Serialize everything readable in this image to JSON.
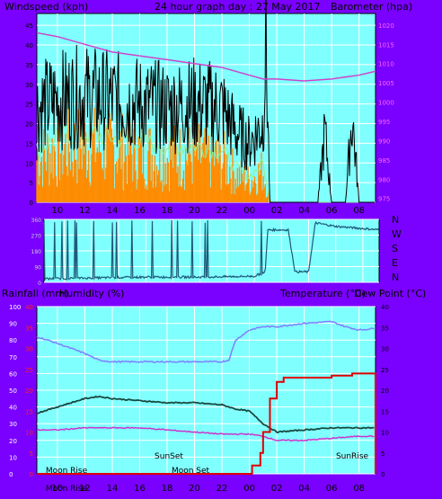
{
  "header": {
    "wind_label": "Windspeed (kph)",
    "title": "24 hour graph day : 27 May 2017",
    "baro_label": "Barometer (hpa)"
  },
  "mid_header": {
    "rain_label": "Rainfall (mm)",
    "humidity_label": "Humidity (%)",
    "temp_label": "Temperature (°C)",
    "dew_label": "Dew Point (°C)"
  },
  "dir_labels": [
    "N",
    "W",
    "S",
    "E",
    "N"
  ],
  "colors": {
    "frame": "#7a00ff",
    "plot_bg": "#80ffff",
    "grid": "#ffffff",
    "wind_gust": "#000000",
    "wind_avg": "#ff8c00",
    "wind_avg_line": "#90ee90",
    "barometer": "#cc44cc",
    "direction": "#1f5a78",
    "rain": "#e00000",
    "humidity": "#7f7fff",
    "temperature": "#1a4a40",
    "dewpoint": "#cc33cc"
  },
  "chart_data": [
    {
      "type": "line",
      "name": "wind-baro",
      "x_ticks": [
        "10",
        "12",
        "14",
        "16",
        "18",
        "20",
        "22",
        "00",
        "02",
        "04",
        "06",
        "08"
      ],
      "y_left_ticks": [
        0,
        5,
        10,
        15,
        20,
        25,
        30,
        35,
        40,
        45
      ],
      "y_right_ticks": [
        975,
        980,
        985,
        990,
        995,
        1000,
        1005,
        1010,
        1015,
        1020
      ],
      "ylim_left": [
        0,
        48
      ],
      "ylim_right": [
        974,
        1023
      ],
      "xlim_hours": [
        8.5,
        33.2
      ],
      "barometer": {
        "x": [
          8.5,
          10,
          12,
          14,
          16,
          18,
          20,
          21,
          22,
          23,
          24,
          25,
          26,
          28,
          30,
          32,
          33.2
        ],
        "y": [
          1018,
          1017,
          1015,
          1013,
          1012,
          1011,
          1010,
          1009.5,
          1009,
          1008,
          1007,
          1006,
          1006,
          1005.5,
          1006,
          1007,
          1008
        ]
      },
      "gust_profile": {
        "x": [
          8.5,
          10,
          12,
          14,
          16,
          18,
          20,
          22,
          23,
          24,
          25,
          25.2,
          25.5,
          28,
          29,
          29.5,
          30,
          31,
          31.5,
          32,
          33.2
        ],
        "y": [
          24,
          26,
          27,
          26,
          25,
          24,
          25,
          24,
          18,
          15,
          20,
          42,
          0,
          0,
          0,
          18,
          0,
          0,
          22,
          0,
          0
        ]
      },
      "avg_profile": {
        "x": [
          8.5,
          10,
          12,
          14,
          16,
          18,
          20,
          22,
          23,
          24,
          25,
          25.5,
          33.2
        ],
        "y": [
          12,
          15,
          16,
          15,
          14,
          13,
          13,
          12,
          8,
          6,
          9,
          0,
          0
        ]
      }
    },
    {
      "type": "line",
      "name": "direction",
      "y_ticks": [
        0,
        90,
        180,
        270,
        360
      ],
      "x": [
        8.5,
        12,
        16,
        20,
        24,
        24.8,
        25,
        26.5,
        27,
        28,
        28.5,
        30,
        33.2
      ],
      "y": [
        20,
        25,
        30,
        30,
        35,
        60,
        300,
        300,
        60,
        60,
        340,
        320,
        300
      ]
    },
    {
      "type": "line",
      "name": "temp-hum-rain",
      "x_ticks": [
        "10",
        "12",
        "14",
        "16",
        "18",
        "20",
        "22",
        "00",
        "02",
        "04",
        "06",
        "08"
      ],
      "y_left_ticks": [
        0,
        10,
        20,
        30,
        40,
        50,
        60,
        70,
        80,
        90,
        100
      ],
      "y_rain_ticks": [
        0,
        5,
        10,
        15,
        20,
        25,
        30,
        35,
        40
      ],
      "y_right_ticks": [
        0,
        5,
        10,
        15,
        20,
        25,
        30,
        35,
        40
      ],
      "annotations": {
        "sunset": "SunSet",
        "sunrise": "SunRise",
        "moonrise": "Moon Rise",
        "moonset": "Moon Set",
        "moonrise_bottom": "Moon Rise"
      },
      "humidity": {
        "x": [
          8.5,
          10,
          12,
          13,
          14,
          16,
          18,
          20,
          22,
          22.5,
          23,
          24,
          25,
          26,
          28,
          30,
          31,
          32,
          33.2
        ],
        "y": [
          82,
          78,
          72,
          68,
          67,
          67,
          67,
          67,
          67,
          68,
          80,
          86,
          88,
          88,
          90,
          91,
          88,
          86,
          87
        ]
      },
      "temperature": {
        "x": [
          8.5,
          10,
          11,
          12,
          13,
          14,
          16,
          18,
          20,
          22,
          23,
          24,
          25,
          26,
          28,
          30,
          32,
          33.2
        ],
        "y": [
          14.5,
          16,
          17,
          18,
          18.5,
          18,
          17.5,
          17,
          17,
          16.5,
          15.5,
          15,
          12,
          10,
          10.5,
          11,
          11,
          11
        ]
      },
      "dewpoint": {
        "x": [
          8.5,
          10,
          12,
          14,
          16,
          18,
          20,
          22,
          24,
          25,
          26,
          28,
          30,
          32,
          33.2
        ],
        "y": [
          10.5,
          10.5,
          11,
          11,
          11,
          10.5,
          10,
          9.5,
          9.5,
          9,
          8,
          8,
          8.5,
          9,
          9
        ]
      },
      "rain": {
        "x": [
          8.5,
          23.5,
          24.2,
          24.8,
          25,
          25.5,
          26,
          26.5,
          28,
          29,
          30,
          31.5,
          32.5,
          33.2
        ],
        "y": [
          0,
          0,
          2,
          5,
          10,
          18,
          22,
          23,
          23,
          23,
          23.5,
          24,
          24,
          0
        ]
      }
    }
  ]
}
